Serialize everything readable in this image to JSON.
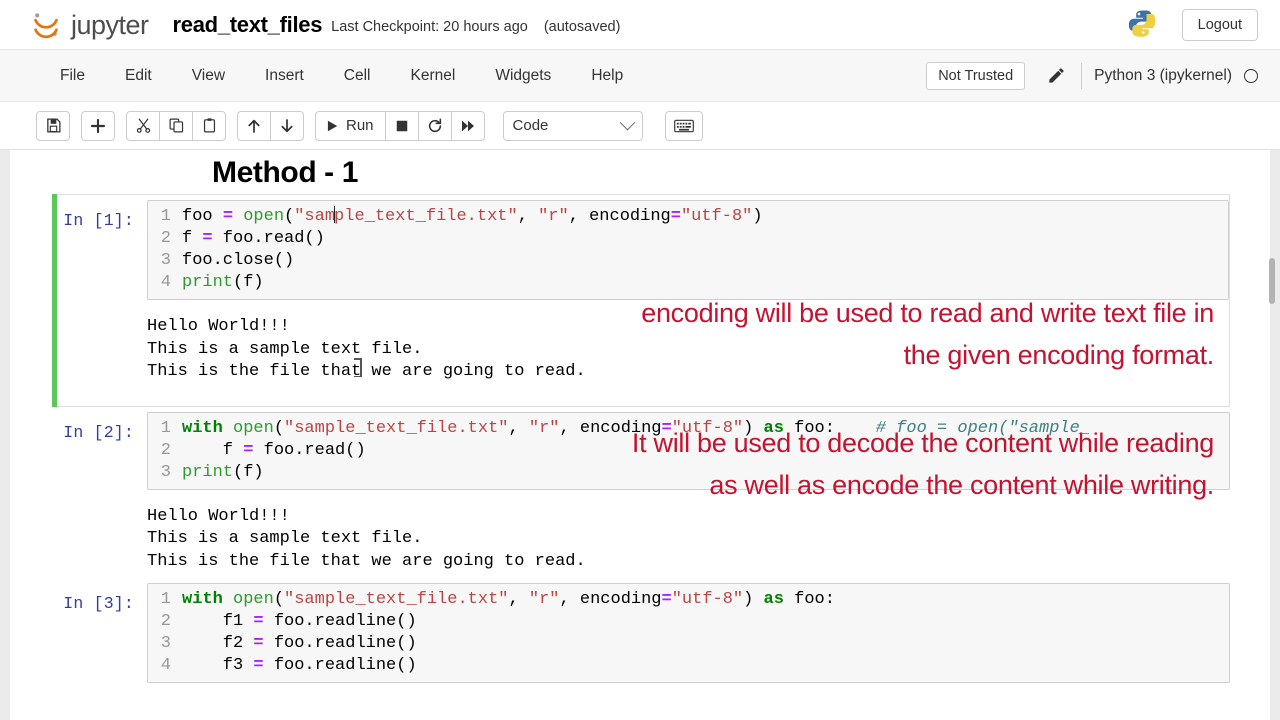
{
  "header": {
    "logo_text": "jupyter",
    "notebook_title": "read_text_files",
    "checkpoint": "Last Checkpoint: 20 hours ago",
    "autosaved": "(autosaved)",
    "logout_label": "Logout"
  },
  "menubar": {
    "items": [
      {
        "label": "File"
      },
      {
        "label": "Edit"
      },
      {
        "label": "View"
      },
      {
        "label": "Insert"
      },
      {
        "label": "Cell"
      },
      {
        "label": "Kernel"
      },
      {
        "label": "Widgets"
      },
      {
        "label": "Help"
      }
    ],
    "trust_status": "Not Trusted",
    "kernel_name": "Python 3 (ipykernel)"
  },
  "toolbar": {
    "save_title": "save-icon",
    "insert_title": "plus-icon",
    "cut_title": "scissors-icon",
    "copy_title": "copy-icon",
    "paste_title": "paste-icon",
    "move_up_title": "arrow-up-icon",
    "move_down_title": "arrow-down-icon",
    "run_label": "Run",
    "stop_title": "stop-icon",
    "restart_title": "restart-icon",
    "restart_run_all_title": "fast-forward-icon",
    "cell_type_value": "Code",
    "keyboard_title": "keyboard-icon"
  },
  "notebook": {
    "markdown_heading": "Method - 1",
    "annotations": [
      {
        "id": "annot-1",
        "text": "encoding will be used to read and write text file in\nthe given encoding format."
      },
      {
        "id": "annot-2",
        "text": "It will be used to decode the content while reading\nas well as encode the content while writing."
      }
    ],
    "cells": [
      {
        "prompt": "In [1]:",
        "selected": true,
        "lines": [
          {
            "n": "1",
            "tokens": [
              {
                "t": "plain",
                "v": "foo "
              },
              {
                "t": "op",
                "v": "="
              },
              {
                "t": "plain",
                "v": " "
              },
              {
                "t": "fn",
                "v": "open"
              },
              {
                "t": "plain",
                "v": "("
              },
              {
                "t": "str",
                "v": "\"sample_text_file.txt\""
              },
              {
                "t": "plain",
                "v": ", "
              },
              {
                "t": "str",
                "v": "\"r\""
              },
              {
                "t": "plain",
                "v": ", encoding"
              },
              {
                "t": "op",
                "v": "="
              },
              {
                "t": "str",
                "v": "\"utf-8\""
              },
              {
                "t": "plain",
                "v": ")"
              }
            ]
          },
          {
            "n": "2",
            "tokens": [
              {
                "t": "plain",
                "v": "f "
              },
              {
                "t": "op",
                "v": "="
              },
              {
                "t": "plain",
                "v": " foo.read()"
              }
            ]
          },
          {
            "n": "3",
            "tokens": [
              {
                "t": "plain",
                "v": "foo.close()"
              }
            ]
          },
          {
            "n": "4",
            "tokens": [
              {
                "t": "fn",
                "v": "print"
              },
              {
                "t": "plain",
                "v": "(f)"
              }
            ]
          }
        ],
        "output": "Hello World!!!\nThis is a sample text file.\nThis is the file that we are going to read."
      },
      {
        "prompt": "In [2]:",
        "selected": false,
        "lines": [
          {
            "n": "1",
            "tokens": [
              {
                "t": "kw",
                "v": "with"
              },
              {
                "t": "plain",
                "v": " "
              },
              {
                "t": "fn",
                "v": "open"
              },
              {
                "t": "plain",
                "v": "("
              },
              {
                "t": "str",
                "v": "\"sample_text_file.txt\""
              },
              {
                "t": "plain",
                "v": ", "
              },
              {
                "t": "str",
                "v": "\"r\""
              },
              {
                "t": "plain",
                "v": ", encoding"
              },
              {
                "t": "op",
                "v": "="
              },
              {
                "t": "str",
                "v": "\"utf-8\""
              },
              {
                "t": "plain",
                "v": ") "
              },
              {
                "t": "kw",
                "v": "as"
              },
              {
                "t": "plain",
                "v": " foo:    "
              },
              {
                "t": "com",
                "v": "# foo = open(\"sample_"
              }
            ]
          },
          {
            "n": "2",
            "tokens": [
              {
                "t": "plain",
                "v": "    f "
              },
              {
                "t": "op",
                "v": "="
              },
              {
                "t": "plain",
                "v": " foo.read()"
              }
            ]
          },
          {
            "n": "3",
            "tokens": [
              {
                "t": "fn",
                "v": "print"
              },
              {
                "t": "plain",
                "v": "(f)"
              }
            ]
          }
        ],
        "output": "Hello World!!!\nThis is a sample text file.\nThis is the file that we are going to read."
      },
      {
        "prompt": "In [3]:",
        "selected": false,
        "lines": [
          {
            "n": "1",
            "tokens": [
              {
                "t": "kw",
                "v": "with"
              },
              {
                "t": "plain",
                "v": " "
              },
              {
                "t": "fn",
                "v": "open"
              },
              {
                "t": "plain",
                "v": "("
              },
              {
                "t": "str",
                "v": "\"sample_text_file.txt\""
              },
              {
                "t": "plain",
                "v": ", "
              },
              {
                "t": "str",
                "v": "\"r\""
              },
              {
                "t": "plain",
                "v": ", encoding"
              },
              {
                "t": "op",
                "v": "="
              },
              {
                "t": "str",
                "v": "\"utf-8\""
              },
              {
                "t": "plain",
                "v": ") "
              },
              {
                "t": "kw",
                "v": "as"
              },
              {
                "t": "plain",
                "v": " foo:"
              }
            ]
          },
          {
            "n": "2",
            "tokens": [
              {
                "t": "plain",
                "v": "    f1 "
              },
              {
                "t": "op",
                "v": "="
              },
              {
                "t": "plain",
                "v": " foo.readline()"
              }
            ]
          },
          {
            "n": "3",
            "tokens": [
              {
                "t": "plain",
                "v": "    f2 "
              },
              {
                "t": "op",
                "v": "="
              },
              {
                "t": "plain",
                "v": " foo.readline()"
              }
            ]
          },
          {
            "n": "4",
            "tokens": [
              {
                "t": "plain",
                "v": "    f3 "
              },
              {
                "t": "op",
                "v": "="
              },
              {
                "t": "plain",
                "v": " foo.readline()"
              }
            ]
          }
        ],
        "output": ""
      }
    ]
  }
}
